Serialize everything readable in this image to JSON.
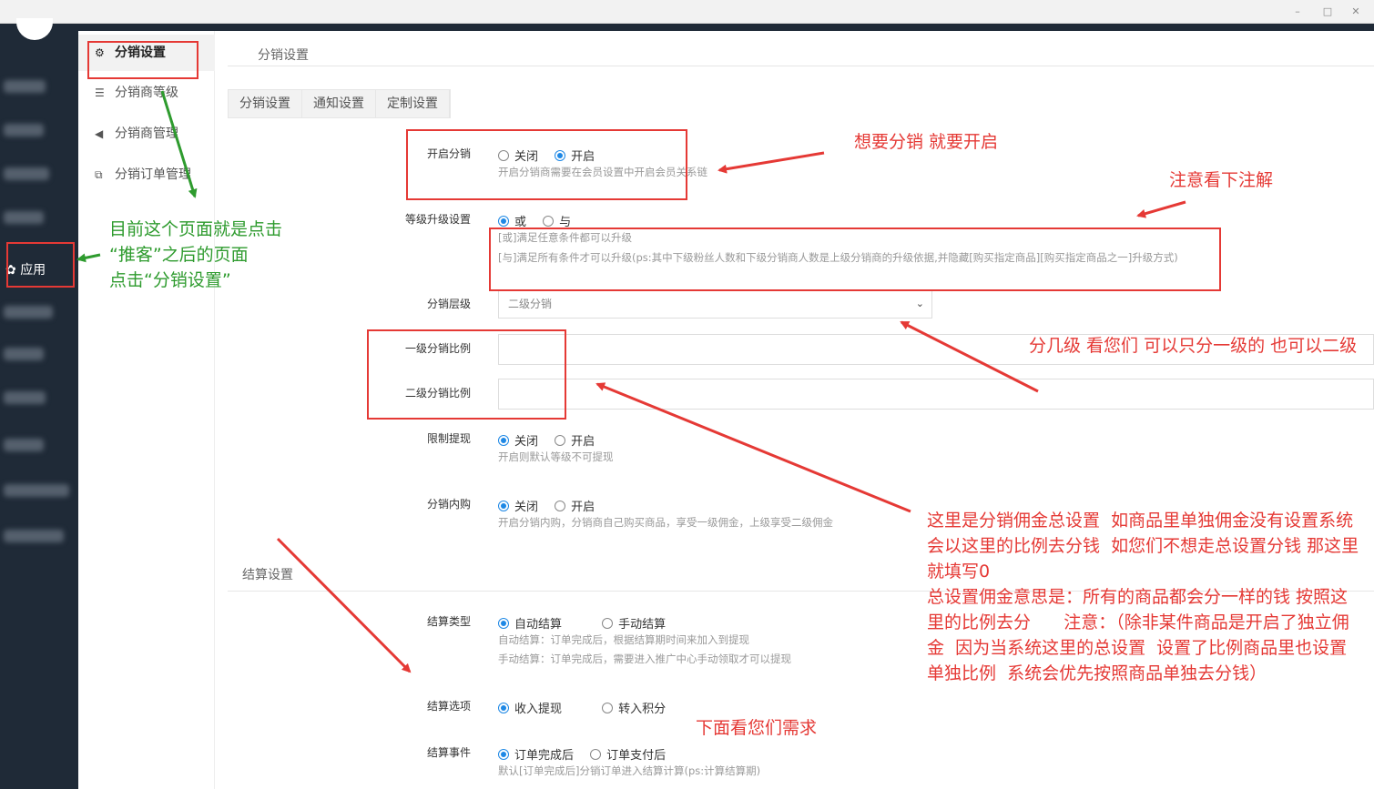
{
  "window": {
    "minimize": "–",
    "maximize": "□",
    "close": "✕"
  },
  "nav": {
    "app_label": "应用"
  },
  "subnav": [
    {
      "label": "分销设置",
      "icon": "gear-icon",
      "glyph": "⚙"
    },
    {
      "label": "分销商等级",
      "icon": "sliders-icon",
      "glyph": "☰"
    },
    {
      "label": "分销商管理",
      "icon": "share-icon",
      "glyph": "◀"
    },
    {
      "label": "分销订单管理",
      "icon": "copy-icon",
      "glyph": "⧉"
    }
  ],
  "page": {
    "title": "分销设置",
    "tabs": [
      "分销设置",
      "通知设置",
      "定制设置"
    ],
    "open_distribution": {
      "label": "开启分销",
      "options": [
        "关闭",
        "开启"
      ],
      "selected": "开启",
      "hint": "开启分销商需要在会员设置中开启会员关系链"
    },
    "level_upgrade": {
      "label": "等级升级设置",
      "options": [
        "或",
        "与"
      ],
      "selected": "或",
      "hint1": "[或]满足任意条件都可以升级",
      "hint2": "[与]满足所有条件才可以升级(ps:其中下级粉丝人数和下级分销商人数是上级分销商的升级依据,并隐藏[购买指定商品][购买指定商品之一]升级方式)"
    },
    "dist_level": {
      "label": "分销层级",
      "value": "二级分销"
    },
    "ratio1": {
      "label": "一级分销比例",
      "value": ""
    },
    "ratio2": {
      "label": "二级分销比例",
      "value": ""
    },
    "limit_withdraw": {
      "label": "限制提现",
      "options": [
        "关闭",
        "开启"
      ],
      "selected": "关闭",
      "hint": "开启则默认等级不可提现"
    },
    "inner_buy": {
      "label": "分销内购",
      "options": [
        "关闭",
        "开启"
      ],
      "selected": "关闭",
      "hint": "开启分销内购，分销商自己购买商品，享受一级佣金，上级享受二级佣金"
    },
    "settle_section": "结算设置",
    "settle_type": {
      "label": "结算类型",
      "options": [
        "自动结算",
        "手动结算"
      ],
      "selected": "自动结算",
      "hint1": "自动结算：订单完成后，根据结算期时间来加入到提现",
      "hint2": "手动结算：订单完成后，需要进入推广中心手动领取才可以提现"
    },
    "settle_option": {
      "label": "结算选项",
      "options": [
        "收入提现",
        "转入积分"
      ],
      "selected": "收入提现"
    },
    "settle_event": {
      "label": "结算事件",
      "options": [
        "订单完成后",
        "订单支付后"
      ],
      "selected": "订单完成后",
      "hint": "默认[订单完成后]分销订单进入结算计算(ps:计算结算期)"
    }
  },
  "annotations": {
    "open_note": "想要分销 就要开启",
    "note_attention": "注意看下注解",
    "level_note": "分几级   看您们 可以只分一级的 也可以二级",
    "ratio_note": "这里是分销佣金总设置  如商品里单独佣金没有设置系统会以这里的比例去分钱  如您们不想走总设置分钱 那这里就填写0\n总设置佣金意思是：所有的商品都会分一样的钱 按照这里的比例去分      注意：（除非某件商品是开启了独立佣金  因为当系统这里的总设置  设置了比例商品里也设置单独比例  系统会优先按照商品单独去分钱）",
    "below_note": "下面看您们需求",
    "green_note": "目前这个页面就是点击\n“推客”之后的页面\n点击“分销设置”"
  }
}
